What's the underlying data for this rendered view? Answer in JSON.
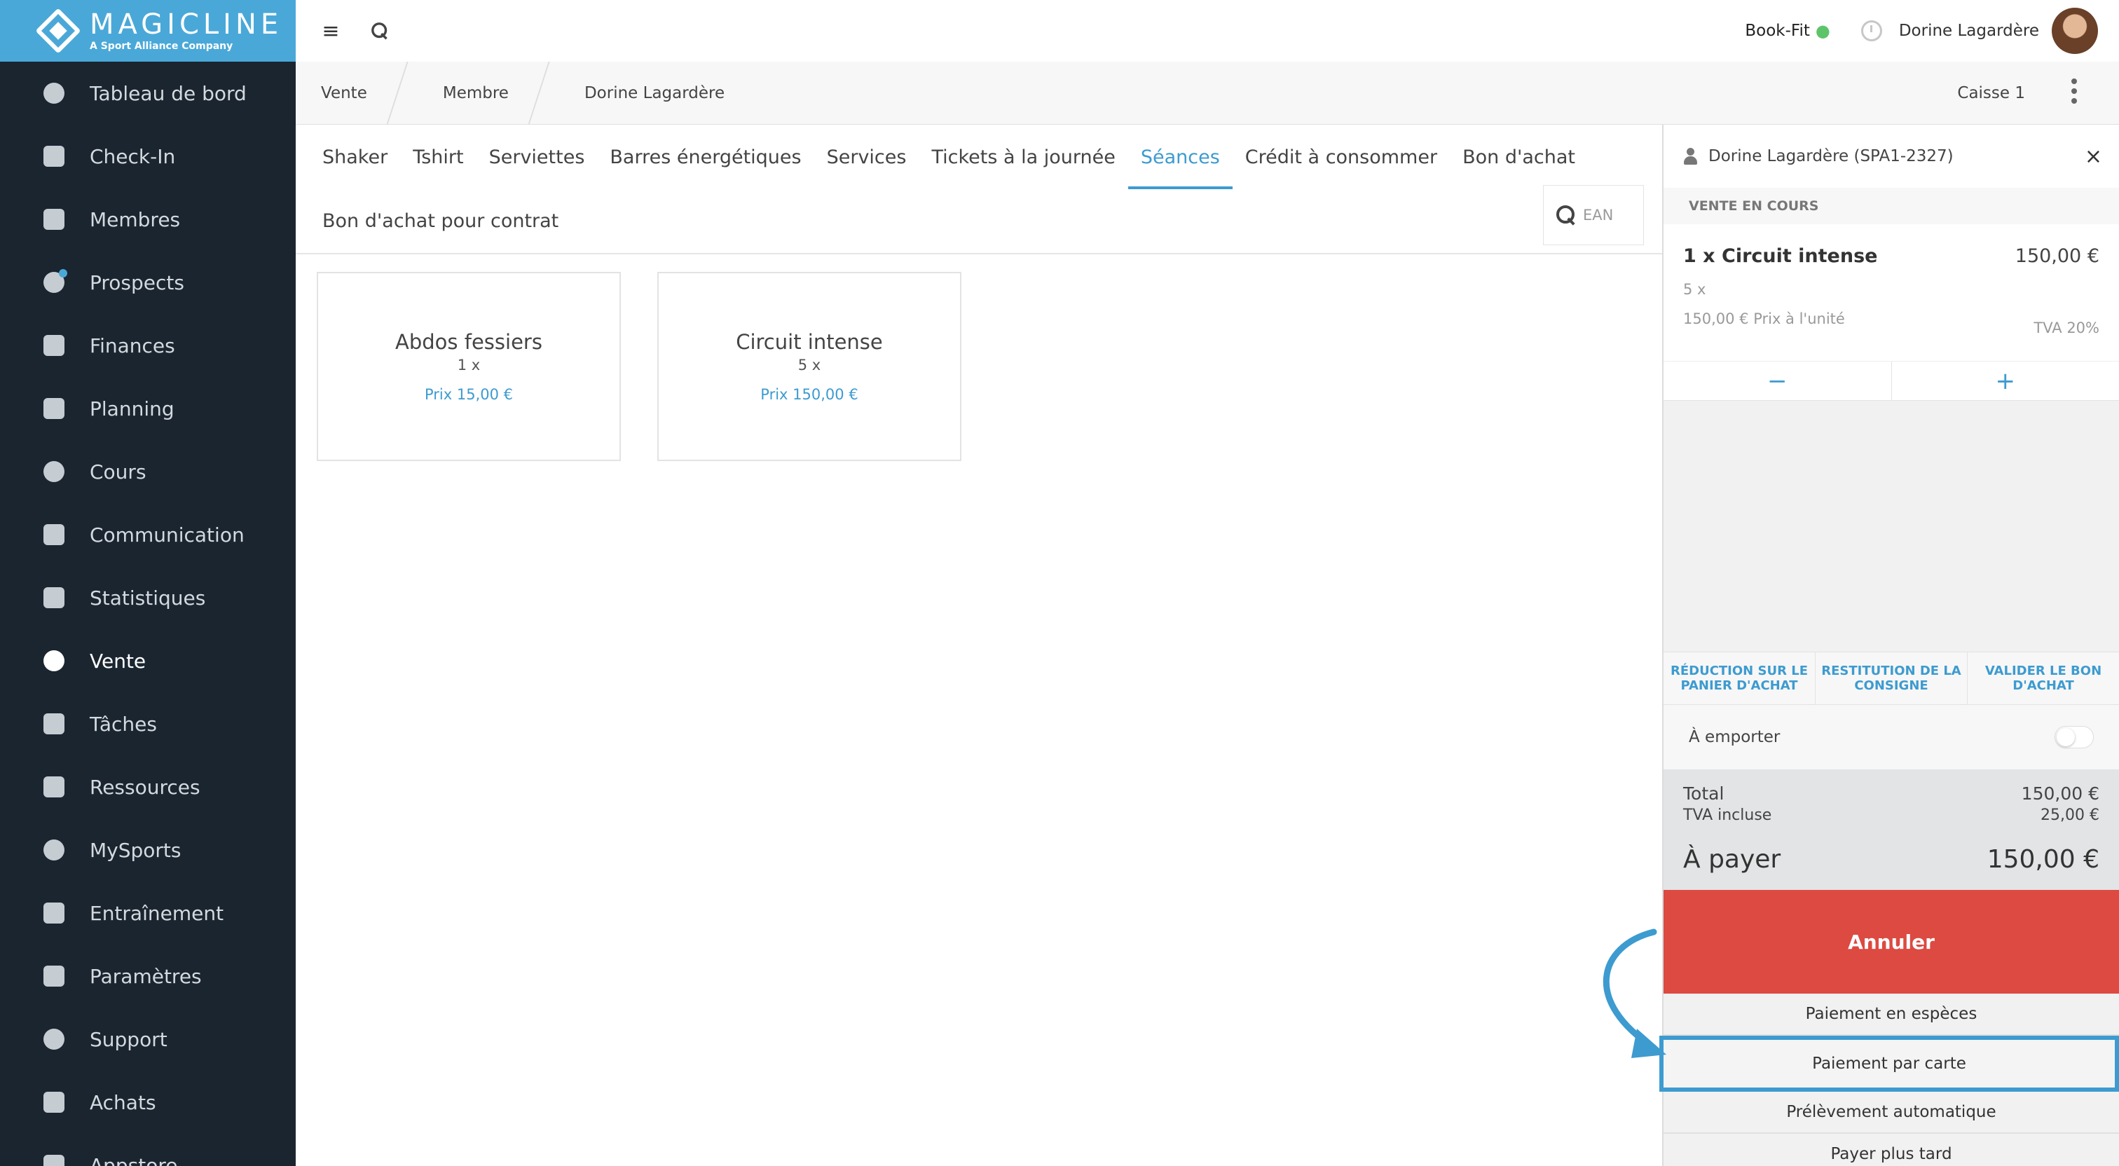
{
  "app": {
    "logo_name": "MAGICLINE",
    "logo_sub": "A Sport Alliance Company",
    "brand_color": "#4aa8d8"
  },
  "sidebar": {
    "items": [
      {
        "label": "Tableau de bord",
        "icon": "dashboard-icon"
      },
      {
        "label": "Check-In",
        "icon": "check-in-icon"
      },
      {
        "label": "Membres",
        "icon": "members-icon"
      },
      {
        "label": "Prospects",
        "icon": "prospects-icon"
      },
      {
        "label": "Finances",
        "icon": "euro-icon"
      },
      {
        "label": "Planning",
        "icon": "calendar-icon"
      },
      {
        "label": "Cours",
        "icon": "stopwatch-icon"
      },
      {
        "label": "Communication",
        "icon": "chat-icon"
      },
      {
        "label": "Statistiques",
        "icon": "chart-icon"
      },
      {
        "label": "Vente",
        "icon": "cart-icon",
        "active": true
      },
      {
        "label": "Tâches",
        "icon": "checkbox-icon"
      },
      {
        "label": "Ressources",
        "icon": "group-icon"
      },
      {
        "label": "MySports",
        "icon": "dots-grid-icon"
      },
      {
        "label": "Entraînement",
        "icon": "dumbbell-icon"
      },
      {
        "label": "Paramètres",
        "icon": "sliders-icon"
      },
      {
        "label": "Support",
        "icon": "help-icon"
      },
      {
        "label": "Achats",
        "icon": "shop-icon"
      },
      {
        "label": "Appstore",
        "icon": "apps-icon"
      }
    ]
  },
  "topbar": {
    "studio": "Book-Fit",
    "user": "Dorine Lagardère"
  },
  "breadcrumb": {
    "items": [
      "Vente",
      "Membre",
      "Dorine Lagardère"
    ],
    "register": "Caisse 1"
  },
  "tabs": {
    "row1": [
      "Shaker",
      "Tshirt",
      "Serviettes",
      "Barres énergétiques",
      "Services",
      "Tickets à la journée",
      "Séances",
      "Crédit à consommer",
      "Bon d'achat"
    ],
    "row2": [
      "Bon d'achat pour contrat"
    ],
    "active": "Séances",
    "search_placeholder": "EAN"
  },
  "products": [
    {
      "title": "Abdos fessiers",
      "qty": "1 x",
      "price": "Prix 15,00 €"
    },
    {
      "title": "Circuit intense",
      "qty": "5 x",
      "price": "Prix 150,00 €"
    }
  ],
  "cart": {
    "customer": "Dorine Lagardère (SPA1-2327)",
    "section": "VENTE EN COURS",
    "item": {
      "name": "1 x Circuit intense",
      "price": "150,00 €",
      "qty": "5 x",
      "unit": "150,00 € Prix à l'unité",
      "vat": "TVA 20%"
    },
    "minus": "−",
    "plus": "+",
    "actions": [
      "RÉDUCTION SUR LE PANIER D'ACHAT",
      "RESTITUTION DE LA CONSIGNE",
      "VALIDER LE BON D'ACHAT"
    ],
    "takeaway": "À emporter",
    "total_label": "Total",
    "total_value": "150,00 €",
    "vat_label": "TVA incluse",
    "vat_value": "25,00 €",
    "pay_label": "À payer",
    "pay_value": "150,00 €",
    "cancel": "Annuler",
    "pay_cash": "Paiement en espèces",
    "pay_card": "Paiement par carte",
    "pay_debit": "Prélèvement automatique",
    "pay_later": "Payer plus tard",
    "cancel_color": "#dc4a42",
    "accent_color": "#3d9bd0"
  }
}
